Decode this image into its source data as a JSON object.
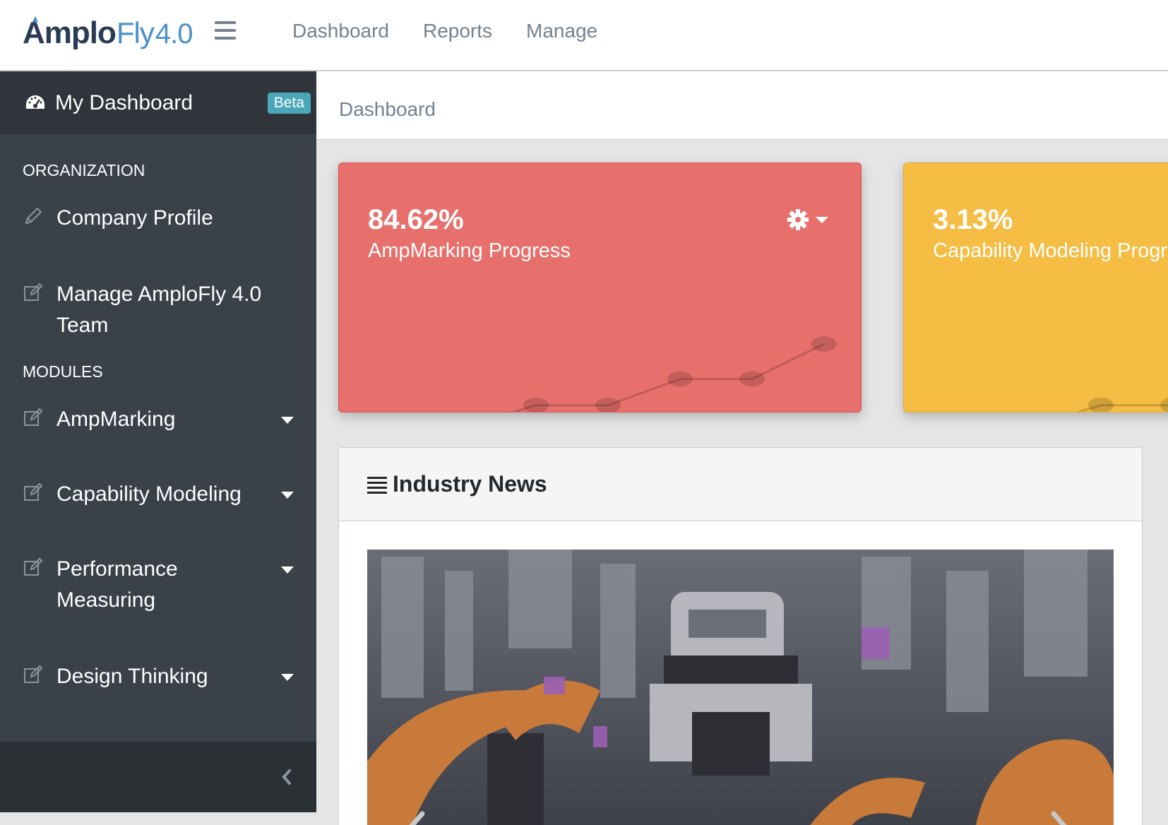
{
  "header": {
    "brand": {
      "amplo": "Amplo",
      "fly": "Fly",
      "version": "4.0"
    },
    "nav": [
      "Dashboard",
      "Reports",
      "Manage"
    ]
  },
  "sidebar": {
    "dashboard_label": "My Dashboard",
    "dashboard_badge": "Beta",
    "section_org": "ORGANIZATION",
    "org_items": [
      {
        "label": "Company Profile",
        "icon": "pencil-icon"
      },
      {
        "label": "Manage AmploFly 4.0 Team",
        "icon": "edit-icon"
      }
    ],
    "section_modules": "MODULES",
    "module_items": [
      {
        "label": "AmpMarking",
        "icon": "edit-icon"
      },
      {
        "label": "Capability Modeling",
        "icon": "edit-icon"
      },
      {
        "label": "Performance Measuring",
        "icon": "edit-icon"
      },
      {
        "label": "Design Thinking",
        "icon": "edit-icon"
      }
    ]
  },
  "breadcrumb": "Dashboard",
  "cards": [
    {
      "value": "84.62%",
      "label": "AmpMarking Progress",
      "color": "#e8706c",
      "trend": [
        2,
        3,
        8,
        8,
        14,
        14,
        22
      ]
    },
    {
      "value": "3.13%",
      "label": "Capability Modeling Progress",
      "color": "#f5bd43",
      "trend": [
        2,
        3,
        8,
        8
      ]
    }
  ],
  "news": {
    "title": "Industry News"
  },
  "colors": {
    "sidebar": "#3a4149",
    "sidebar_dark": "#2f353a",
    "badge": "#4aa7b8",
    "card_red": "#e8706c",
    "card_yellow": "#f5bd43"
  }
}
